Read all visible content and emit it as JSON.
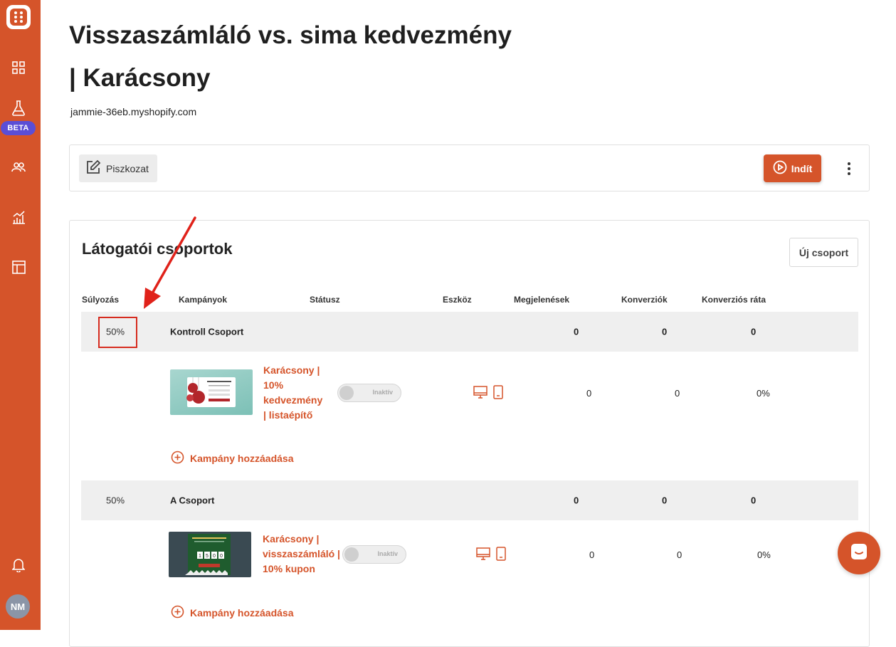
{
  "sidebar": {
    "beta_label": "BETA",
    "avatar_initials": "NM",
    "icons": [
      "dashboard-icon",
      "flask-icon",
      "users-icon",
      "analytics-icon",
      "layout-icon",
      "bell-icon"
    ]
  },
  "page": {
    "title_line1": "Visszaszámláló vs. sima kedvezmény",
    "title_line2": "| Karácsony",
    "domain": "jammie-36eb.myshopify.com"
  },
  "toolbar": {
    "draft_label": "Piszkozat",
    "start_label": "Indít"
  },
  "groups_card": {
    "title": "Látogatói csoportok",
    "new_group_label": "Új csoport",
    "columns": [
      "Súlyozás",
      "Kampányok",
      "Státusz",
      "Eszköz",
      "Megjelenések",
      "Konverziók",
      "Konverziós ráta"
    ],
    "add_campaign_label": "Kampány hozzáadása",
    "groups": [
      {
        "weight": "50%",
        "name": "Kontroll Csoport",
        "impressions": "0",
        "conversions": "0",
        "rate": "0",
        "campaign": {
          "name": "Karácsony | 10% kedvezmény | listaépítő",
          "status": "Inaktív",
          "impressions": "0",
          "conversions": "0",
          "rate": "0%"
        }
      },
      {
        "weight": "50%",
        "name": "A Csoport",
        "impressions": "0",
        "conversions": "0",
        "rate": "0",
        "campaign": {
          "name": "Karácsony | visszaszámláló | 10% kupon",
          "status": "Inaktív",
          "impressions": "0",
          "conversions": "0",
          "rate": "0%",
          "countdown_digits": [
            "1",
            "5",
            "0",
            "0"
          ]
        }
      }
    ]
  },
  "colors": {
    "brand": "#d5542a",
    "beta": "#5b4ed6",
    "highlight": "#d62b1f"
  }
}
